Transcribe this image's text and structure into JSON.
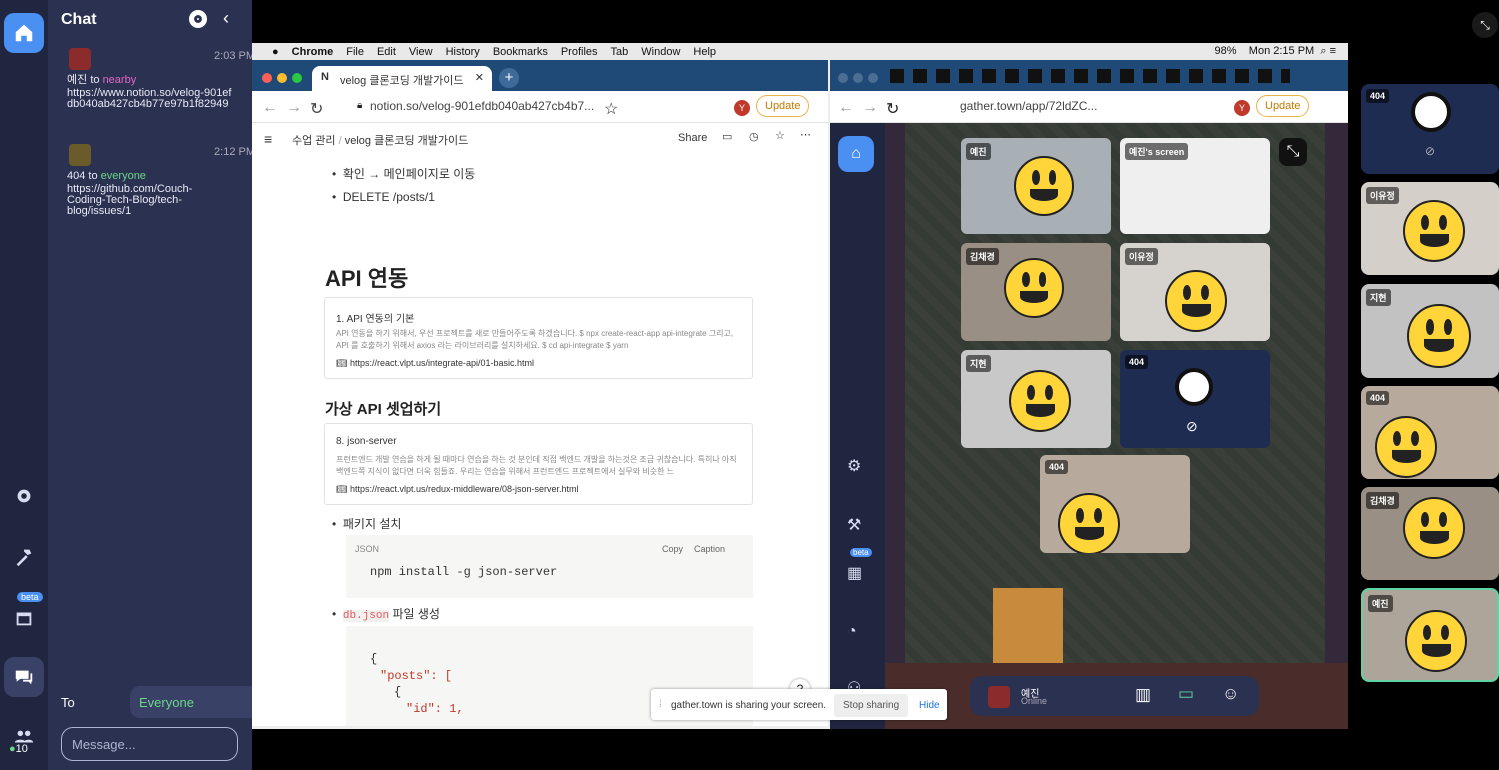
{
  "chat": {
    "title": "Chat",
    "messages": [
      {
        "sender": "예진",
        "to_word": "to",
        "scope": "nearby",
        "time": "2:03 PM",
        "text": "https://www.notion.so/velog-901efdb040ab427cb4b77e97b1f82949"
      },
      {
        "sender": "404",
        "to_word": "to",
        "scope": "everyone",
        "time": "2:12 PM",
        "text": "https://github.com/Couch-Coding-Tech-Blog/tech-blog/issues/1"
      }
    ],
    "to_label": "To",
    "recipient": "Everyone",
    "message_placeholder": "Message...",
    "online_count": "10",
    "beta_label": "beta"
  },
  "menubar": {
    "items": [
      "Chrome",
      "File",
      "Edit",
      "View",
      "History",
      "Bookmarks",
      "Profiles",
      "Tab",
      "Window",
      "Help"
    ],
    "battery": "98%",
    "clock": "Mon 2:15 PM"
  },
  "left_browser": {
    "tab_title": "velog 클론코딩 개발가이드",
    "url": "notion.so/velog-901efdb040ab427cb4b7...",
    "update_label": "Update",
    "profile_initial": "Y",
    "breadcrumb_parent": "수업 관리",
    "breadcrumb_sep": "/",
    "breadcrumb_current": "velog 클론코딩 개발가이드",
    "share_label": "Share",
    "bullet1": "확인 → 메인페이지로 이동",
    "bullet2": "DELETE /posts/1",
    "heading_api": "API 연동",
    "card1_title": "1. API 연동의 기본",
    "card1_desc": "API 연동을 하기 위해서, 우선 프로젝트를 새로 만들어주도록 하겠습니다. $ npx create-react-app api-integrate 그리고, API 를 호출하기 위해서 axios 라는 라이브러리를 설치하세요. $ cd api-integrate $ yarn",
    "card1_url": "https://react.vlpt.us/integrate-api/01-basic.html",
    "heading_mock": "가상 API 셋업하기",
    "card2_title": "8. json-server",
    "card2_desc": "프런트엔드 개발 연습을 하게 될 때마다 연습을 하는 것 분인데 직접 백엔드 개발을 하는것은 조금 귀찮습니다. 특히나 아직 백엔드쪽 지식이 없다면 더욱 힘들죠. 우리는 연습을 위해서 프런트엔드 프로젝트에서 실무와 비슷한 느",
    "card2_url": "https://react.vlpt.us/redux-middleware/08-json-server.html",
    "bullet3": "패키지 설치",
    "code_lang": "JSON",
    "copy_label": "Copy",
    "caption_label": "Caption",
    "code1": "npm install -g json-server",
    "bullet4_code": "db.json",
    "bullet4_text": "파일 생성",
    "code2_l1": "{",
    "code2_l2": "\"posts\": [",
    "code2_l3": "{",
    "code2_l4": "\"id\": 1,",
    "help": "?"
  },
  "right_browser": {
    "url": "gather.town/app/72ldZC...",
    "update_label": "Update",
    "profile_initial": "Y",
    "beta_label": "beta"
  },
  "video_tiles": [
    {
      "name": "예진"
    },
    {
      "name": "예진's screen"
    },
    {
      "name": "김채경"
    },
    {
      "name": "이유정"
    },
    {
      "name": "지현"
    },
    {
      "name": "404"
    },
    {
      "name": "404"
    }
  ],
  "participants": [
    {
      "name": "404"
    },
    {
      "name": "이유정"
    },
    {
      "name": "지현"
    },
    {
      "name": "404"
    },
    {
      "name": "김채경"
    },
    {
      "name": "예진"
    }
  ],
  "share_notice": {
    "text": "gather.town is sharing your screen.",
    "stop": "Stop sharing",
    "hide": "Hide"
  },
  "bottom_bar": {
    "name": "예진",
    "status": "Online"
  },
  "colors": {
    "rail": "#202540",
    "chat_panel": "#2b3150",
    "accent_green": "#6cd68a",
    "nearby_pink": "#e466c6"
  }
}
